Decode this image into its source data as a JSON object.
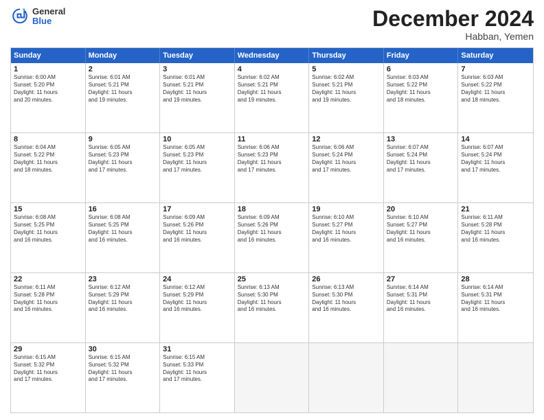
{
  "logo": {
    "general": "General",
    "blue": "Blue"
  },
  "title": "December 2024",
  "location": "Habban, Yemen",
  "days": [
    "Sunday",
    "Monday",
    "Tuesday",
    "Wednesday",
    "Thursday",
    "Friday",
    "Saturday"
  ],
  "rows": [
    [
      {
        "day": "1",
        "text": "Sunrise: 6:00 AM\nSunset: 5:20 PM\nDaylight: 11 hours\nand 20 minutes."
      },
      {
        "day": "2",
        "text": "Sunrise: 6:01 AM\nSunset: 5:21 PM\nDaylight: 11 hours\nand 19 minutes."
      },
      {
        "day": "3",
        "text": "Sunrise: 6:01 AM\nSunset: 5:21 PM\nDaylight: 11 hours\nand 19 minutes."
      },
      {
        "day": "4",
        "text": "Sunrise: 6:02 AM\nSunset: 5:21 PM\nDaylight: 11 hours\nand 19 minutes."
      },
      {
        "day": "5",
        "text": "Sunrise: 6:02 AM\nSunset: 5:21 PM\nDaylight: 11 hours\nand 19 minutes."
      },
      {
        "day": "6",
        "text": "Sunrise: 6:03 AM\nSunset: 5:22 PM\nDaylight: 11 hours\nand 18 minutes."
      },
      {
        "day": "7",
        "text": "Sunrise: 6:03 AM\nSunset: 5:22 PM\nDaylight: 11 hours\nand 18 minutes."
      }
    ],
    [
      {
        "day": "8",
        "text": "Sunrise: 6:04 AM\nSunset: 5:22 PM\nDaylight: 11 hours\nand 18 minutes."
      },
      {
        "day": "9",
        "text": "Sunrise: 6:05 AM\nSunset: 5:23 PM\nDaylight: 11 hours\nand 17 minutes."
      },
      {
        "day": "10",
        "text": "Sunrise: 6:05 AM\nSunset: 5:23 PM\nDaylight: 11 hours\nand 17 minutes."
      },
      {
        "day": "11",
        "text": "Sunrise: 6:06 AM\nSunset: 5:23 PM\nDaylight: 11 hours\nand 17 minutes."
      },
      {
        "day": "12",
        "text": "Sunrise: 6:06 AM\nSunset: 5:24 PM\nDaylight: 11 hours\nand 17 minutes."
      },
      {
        "day": "13",
        "text": "Sunrise: 6:07 AM\nSunset: 5:24 PM\nDaylight: 11 hours\nand 17 minutes."
      },
      {
        "day": "14",
        "text": "Sunrise: 6:07 AM\nSunset: 5:24 PM\nDaylight: 11 hours\nand 17 minutes."
      }
    ],
    [
      {
        "day": "15",
        "text": "Sunrise: 6:08 AM\nSunset: 5:25 PM\nDaylight: 11 hours\nand 16 minutes."
      },
      {
        "day": "16",
        "text": "Sunrise: 6:08 AM\nSunset: 5:25 PM\nDaylight: 11 hours\nand 16 minutes."
      },
      {
        "day": "17",
        "text": "Sunrise: 6:09 AM\nSunset: 5:26 PM\nDaylight: 11 hours\nand 16 minutes."
      },
      {
        "day": "18",
        "text": "Sunrise: 6:09 AM\nSunset: 5:26 PM\nDaylight: 11 hours\nand 16 minutes."
      },
      {
        "day": "19",
        "text": "Sunrise: 6:10 AM\nSunset: 5:27 PM\nDaylight: 11 hours\nand 16 minutes."
      },
      {
        "day": "20",
        "text": "Sunrise: 6:10 AM\nSunset: 5:27 PM\nDaylight: 11 hours\nand 16 minutes."
      },
      {
        "day": "21",
        "text": "Sunrise: 6:11 AM\nSunset: 5:28 PM\nDaylight: 11 hours\nand 16 minutes."
      }
    ],
    [
      {
        "day": "22",
        "text": "Sunrise: 6:11 AM\nSunset: 5:28 PM\nDaylight: 11 hours\nand 16 minutes."
      },
      {
        "day": "23",
        "text": "Sunrise: 6:12 AM\nSunset: 5:29 PM\nDaylight: 11 hours\nand 16 minutes."
      },
      {
        "day": "24",
        "text": "Sunrise: 6:12 AM\nSunset: 5:29 PM\nDaylight: 11 hours\nand 16 minutes."
      },
      {
        "day": "25",
        "text": "Sunrise: 6:13 AM\nSunset: 5:30 PM\nDaylight: 11 hours\nand 16 minutes."
      },
      {
        "day": "26",
        "text": "Sunrise: 6:13 AM\nSunset: 5:30 PM\nDaylight: 11 hours\nand 16 minutes."
      },
      {
        "day": "27",
        "text": "Sunrise: 6:14 AM\nSunset: 5:31 PM\nDaylight: 11 hours\nand 16 minutes."
      },
      {
        "day": "28",
        "text": "Sunrise: 6:14 AM\nSunset: 5:31 PM\nDaylight: 11 hours\nand 16 minutes."
      }
    ],
    [
      {
        "day": "29",
        "text": "Sunrise: 6:15 AM\nSunset: 5:32 PM\nDaylight: 11 hours\nand 17 minutes."
      },
      {
        "day": "30",
        "text": "Sunrise: 6:15 AM\nSunset: 5:32 PM\nDaylight: 11 hours\nand 17 minutes."
      },
      {
        "day": "31",
        "text": "Sunrise: 6:15 AM\nSunset: 5:33 PM\nDaylight: 11 hours\nand 17 minutes."
      },
      {
        "day": "",
        "text": ""
      },
      {
        "day": "",
        "text": ""
      },
      {
        "day": "",
        "text": ""
      },
      {
        "day": "",
        "text": ""
      }
    ]
  ]
}
